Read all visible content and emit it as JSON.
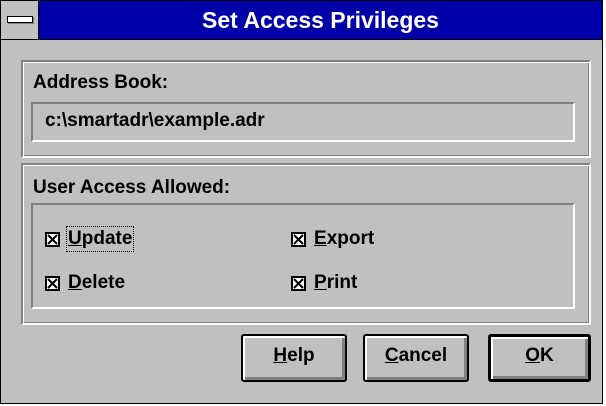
{
  "window": {
    "title": "Set Access Privileges"
  },
  "address_book": {
    "label": "Address Book:",
    "path": "c:\\smartadr\\example.adr"
  },
  "user_access": {
    "label": "User Access Allowed:",
    "options": [
      {
        "label_underlined": "U",
        "label_rest": "pdate",
        "checked": true
      },
      {
        "label_underlined": "D",
        "label_rest": "elete",
        "checked": true
      },
      {
        "label_underlined": "E",
        "label_rest": "xport",
        "checked": true
      },
      {
        "label_underlined": "P",
        "label_rest": "rint",
        "checked": true
      }
    ]
  },
  "buttons": {
    "help": {
      "underlined": "H",
      "rest": "elp"
    },
    "cancel": {
      "underlined": "C",
      "rest": "ancel"
    },
    "ok": {
      "underlined": "O",
      "rest": "K"
    }
  },
  "colors": {
    "titlebar": "#0000a8",
    "face": "#c0c0c0"
  }
}
